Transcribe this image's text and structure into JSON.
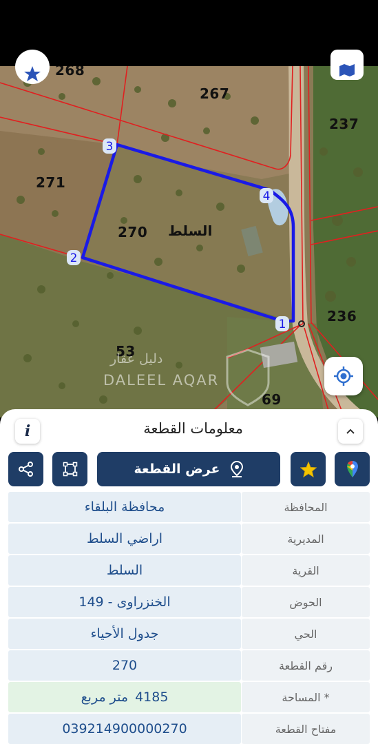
{
  "map": {
    "parcel_numbers": {
      "p268": "268",
      "p267": "267",
      "p237": "237",
      "p271": "271",
      "p270": "270",
      "p236": "236",
      "p53": "53",
      "p69": "69"
    },
    "plot_name": "السلط",
    "vertices": [
      "1",
      "2",
      "3",
      "4"
    ],
    "watermark_ar": "دليل عقار",
    "watermark_en": "DALEEL AQAR"
  },
  "sheet": {
    "title": "معلومات القطعة",
    "view_plot_label": "عرض القطعة"
  },
  "info": {
    "rows": [
      {
        "label": "المحافظة",
        "value": "محافظة البلقاء"
      },
      {
        "label": "المديرية",
        "value": "اراضي السلط"
      },
      {
        "label": "القرية",
        "value": "السلط"
      },
      {
        "label": "الحوض",
        "value": "الخنزراوى - 149"
      },
      {
        "label": "الحي",
        "value": "جدول الأحياء"
      },
      {
        "label": "رقم القطعة",
        "value": "270"
      },
      {
        "label": "المساحة *",
        "value": "4185",
        "unit": "متر مربع"
      },
      {
        "label": "مفتاح القطعة",
        "value": "039214900000270"
      }
    ]
  },
  "colors": {
    "accent": "#1f3d66",
    "value_text": "#1f4e8c",
    "boundary": "#e02020",
    "plot_outline": "#1a1ae6",
    "star": "#f5c400"
  },
  "icons": {
    "favorite": "star-icon",
    "location": "location-pin-icon",
    "share": "share-icon",
    "outline": "polygon-icon",
    "info": "info-icon",
    "collapse": "chevron-up-icon",
    "google_maps": "google-maps-icon",
    "recenter": "crosshair-icon"
  }
}
